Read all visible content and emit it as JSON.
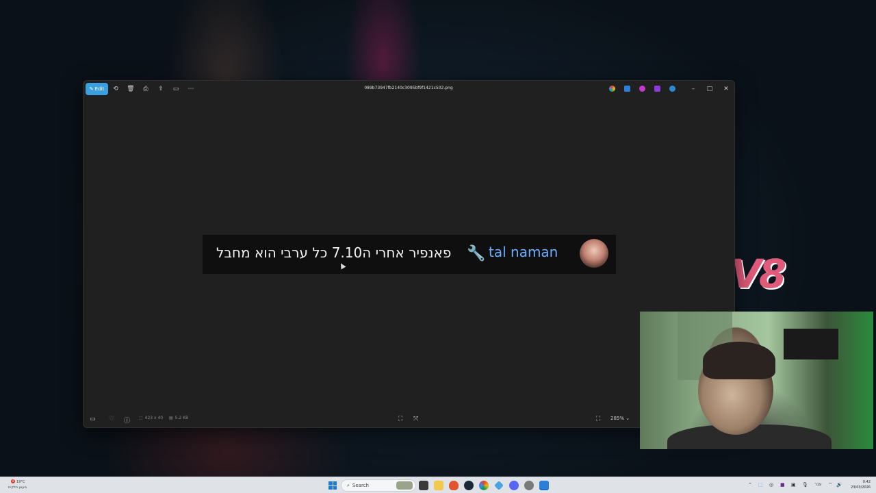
{
  "window": {
    "edit_label": "Edit",
    "file_name": "089b73947fb2140c3095bf9f1421c502.png"
  },
  "image": {
    "username": "tal naman",
    "message": "פאנפיר אחרי ה7.10 כל ערבי הוא מחבל"
  },
  "bottombar": {
    "dimensions": "423 x 40",
    "file_size": "5.2 KB",
    "zoom": "285%"
  },
  "taskbar": {
    "weather_line1": "19°C",
    "weather_line2": "מעונן חלקית",
    "weather_badge": "4",
    "search_label": "Search",
    "lang": "עבר",
    "time": "0:42",
    "date": "23/03/2026"
  },
  "wallpaper": {
    "logo_text": "V8"
  },
  "colors": {
    "accent": "#3aa0e0",
    "username": "#6ab0ff",
    "taskbar": "#dfe3e8"
  }
}
